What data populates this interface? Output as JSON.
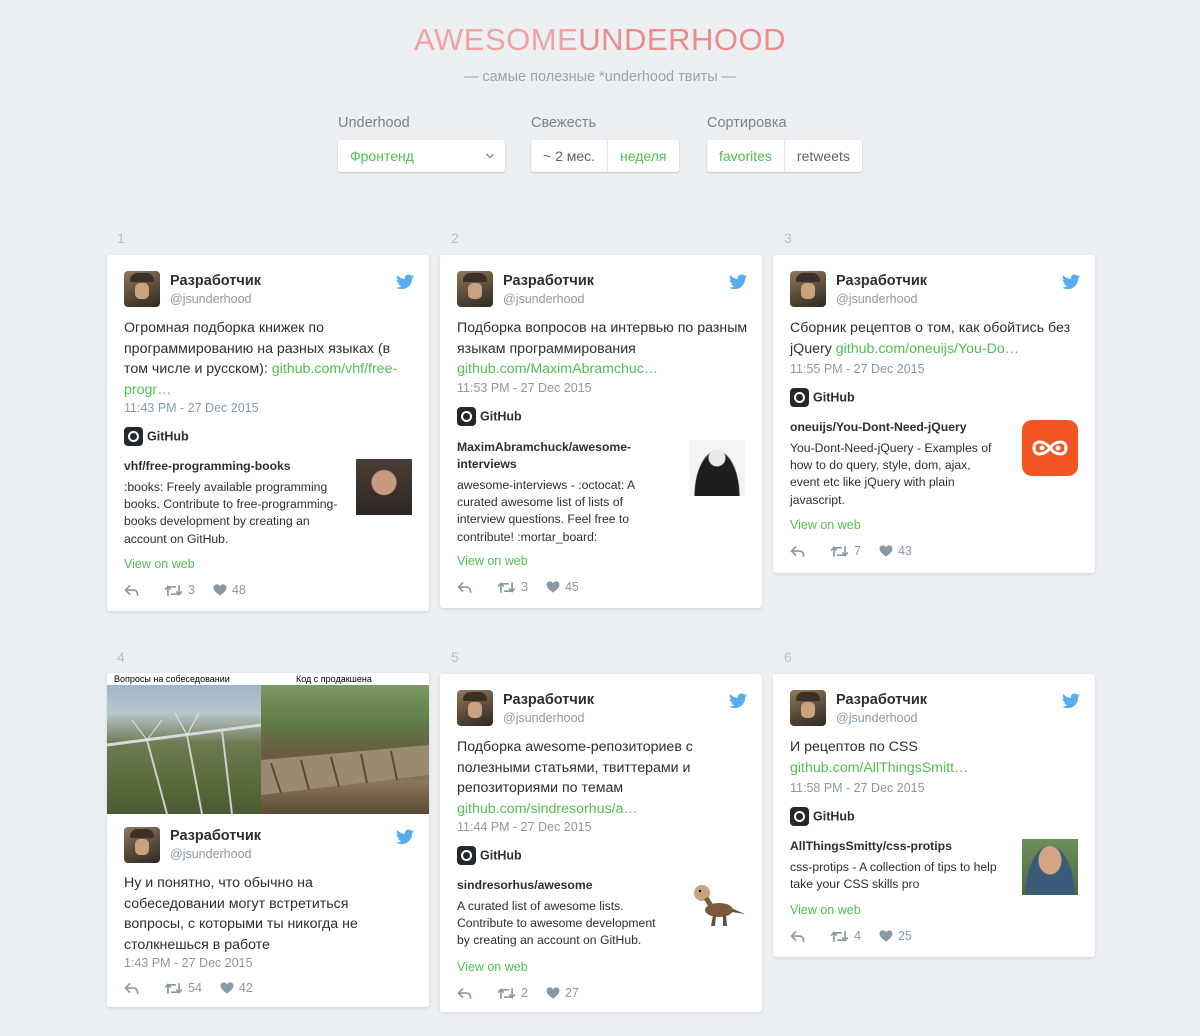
{
  "header": {
    "logo_part1": "AWESOME",
    "logo_part2": "UNDERHOOD",
    "subtitle": "— самые полезные *underhood твиты —"
  },
  "filters": {
    "underhood": {
      "label": "Underhood",
      "value": "Фронтенд"
    },
    "freshness": {
      "label": "Свежесть",
      "options": [
        "~ 2 мес.",
        "неделя"
      ],
      "active": "неделя"
    },
    "sort": {
      "label": "Сортировка",
      "options": [
        "favorites",
        "retweets"
      ],
      "active": "favorites"
    }
  },
  "colors": {
    "accent": "#4fbf4f",
    "logo": "#ee8a8e",
    "twitter": "#55acee",
    "background": "#ecf0f3"
  },
  "tweets": [
    {
      "num": "1",
      "name": "Разработчик",
      "handle": "@jsunderhood",
      "text": "Огромная подборка книжек по программированию на разных языках (в том числе и русском): ",
      "link": "github.com/vhf/free-progr…",
      "date": "11:43 PM - 27 Dec 2015",
      "github": "GitHub",
      "repo": "vhf/free-programming-books",
      "repo_desc": ":books: Freely available programming books. Contribute to free-programming-books development by creating an account on GitHub.",
      "view": "View on web",
      "retweets": "3",
      "likes": "48"
    },
    {
      "num": "2",
      "name": "Разработчик",
      "handle": "@jsunderhood",
      "text": "Подборка вопросов на интервью по разным языкам программирования ",
      "link": "github.com/MaximAbramchuc…",
      "date": "11:53 PM - 27 Dec 2015",
      "github": "GitHub",
      "repo": "MaximAbramchuck/awesome-interviews",
      "repo_desc": "awesome-interviews - :octocat: A curated awesome list of lists of interview questions. Feel free to contribute! :mortar_board:",
      "view": "View on web",
      "retweets": "3",
      "likes": "45"
    },
    {
      "num": "3",
      "name": "Разработчик",
      "handle": "@jsunderhood",
      "text": "Сборник рецептов о том, как обойтись без jQuery ",
      "link": "github.com/oneuijs/You-Do…",
      "date": "11:55 PM - 27 Dec 2015",
      "github": "GitHub",
      "repo": "oneuijs/You-Dont-Need-jQuery",
      "repo_desc": "You-Dont-Need-jQuery - Examples of how to do query, style, dom, ajax, event etc like jQuery with plain javascript.",
      "view": "View on web",
      "retweets": "7",
      "likes": "43"
    },
    {
      "num": "4",
      "photo_left": "Вопросы на собеседовании",
      "photo_right": "Код с продакшена",
      "name": "Разработчик",
      "handle": "@jsunderhood",
      "text": "Ну и понятно, что обычно на собеседовании могут встретиться вопросы, с которыми ты никогда не столкнешься в работе",
      "date": "1:43 PM - 27 Dec 2015",
      "retweets": "54",
      "likes": "42"
    },
    {
      "num": "5",
      "name": "Разработчик",
      "handle": "@jsunderhood",
      "text": "Подборка awesome-репозиториев с полезными статьями, твиттерами и репозиториями по темам ",
      "link": "github.com/sindresorhus/a…",
      "date": "11:44 PM - 27 Dec 2015",
      "github": "GitHub",
      "repo": "sindresorhus/awesome",
      "repo_desc": "A curated list of awesome lists. Contribute to awesome development by creating an account on GitHub.",
      "view": "View on web",
      "retweets": "2",
      "likes": "27"
    },
    {
      "num": "6",
      "name": "Разработчик",
      "handle": "@jsunderhood",
      "text": "И рецептов по CSS ",
      "link": "github.com/AllThingsSmitt…",
      "date": "11:58 PM - 27 Dec 2015",
      "github": "GitHub",
      "repo": "AllThingsSmitty/css-protips",
      "repo_desc": "css-protips - A collection of tips to help take your CSS skills pro",
      "view": "View on web",
      "retweets": "4",
      "likes": "25"
    }
  ]
}
